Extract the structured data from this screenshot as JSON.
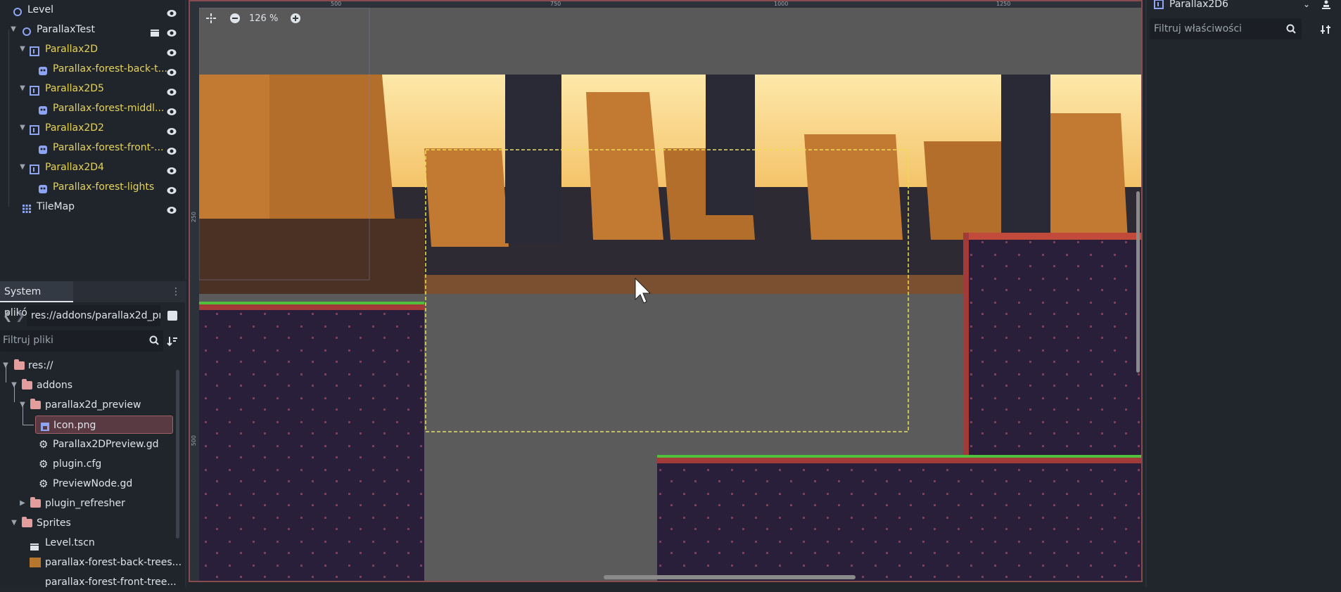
{
  "scene_tree": {
    "items": [
      {
        "label": "Level"
      },
      {
        "label": "ParallaxTest"
      },
      {
        "label": "Parallax2D"
      },
      {
        "label": "Parallax-forest-back-t..."
      },
      {
        "label": "Parallax2D5"
      },
      {
        "label": "Parallax-forest-middl..."
      },
      {
        "label": "Parallax2D2"
      },
      {
        "label": "Parallax-forest-front-..."
      },
      {
        "label": "Parallax2D4"
      },
      {
        "label": "Parallax-forest-lights"
      },
      {
        "label": "TileMap"
      }
    ]
  },
  "filesystem": {
    "title": "System plików",
    "path": "res://addons/parallax2d_pr",
    "filter_placeholder": "Filtruj pliki",
    "items": [
      {
        "label": "res://"
      },
      {
        "label": "addons"
      },
      {
        "label": "parallax2d_preview"
      },
      {
        "label": "Icon.png"
      },
      {
        "label": "Parallax2DPreview.gd"
      },
      {
        "label": "plugin.cfg"
      },
      {
        "label": "PreviewNode.gd"
      },
      {
        "label": "plugin_refresher"
      },
      {
        "label": "Sprites"
      },
      {
        "label": "Level.tscn"
      },
      {
        "label": "parallax-forest-back-trees..."
      },
      {
        "label": "parallax-forest-front-tree..."
      }
    ]
  },
  "viewport": {
    "zoom": "126 %",
    "ruler_marks": [
      "500",
      "750",
      "1000",
      "1250"
    ],
    "ruler_v_marks": [
      "250",
      "500"
    ]
  },
  "inspector": {
    "node_name": "Parallax2D6",
    "filter_placeholder": "Filtruj właściwości"
  },
  "colors": {
    "accent_yellow": "#e6d45a",
    "node_icon_blue": "#8da5f3",
    "folder_pink": "#e39d9d",
    "selection_red": "#8a4b4f"
  }
}
